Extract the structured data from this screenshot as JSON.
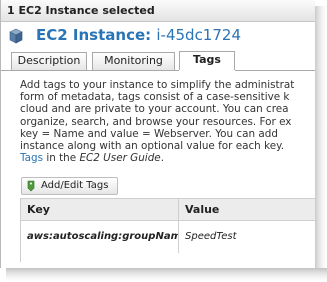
{
  "title_bar": {
    "text": "1 EC2 Instance selected"
  },
  "header": {
    "title_prefix": "EC2 Instance:",
    "instance_id": "i-45dc1724",
    "icon": "cube-icon"
  },
  "tabs": [
    {
      "label": "Description",
      "active": false
    },
    {
      "label": "Monitoring",
      "active": false
    },
    {
      "label": "Tags",
      "active": true
    }
  ],
  "description": {
    "line1": "Add tags to your instance to simplify the administrat",
    "line2": "form of metadata, tags consist of a case-sensitive k",
    "line3": "cloud and are private to your account. You can crea",
    "line4": "organize, search, and browse your resources. For ex",
    "line5": "key = Name and value = Webserver. You can add",
    "line6": "instance along with an optional value for each key.",
    "line7_link": "Tags",
    "line7_middle": " in the ",
    "line7_emph": "EC2 User Guide",
    "line7_end": "."
  },
  "add_tags_button": {
    "label": "Add/Edit Tags",
    "icon": "tag-icon"
  },
  "table": {
    "columns": [
      "Key",
      "Value"
    ],
    "rows": [
      {
        "key": "aws:autoscaling:groupName",
        "value": "SpeedTest"
      }
    ]
  },
  "colors": {
    "accent": "#2a73b5",
    "header_bg": "#ececec",
    "border": "#a9a9a9"
  }
}
